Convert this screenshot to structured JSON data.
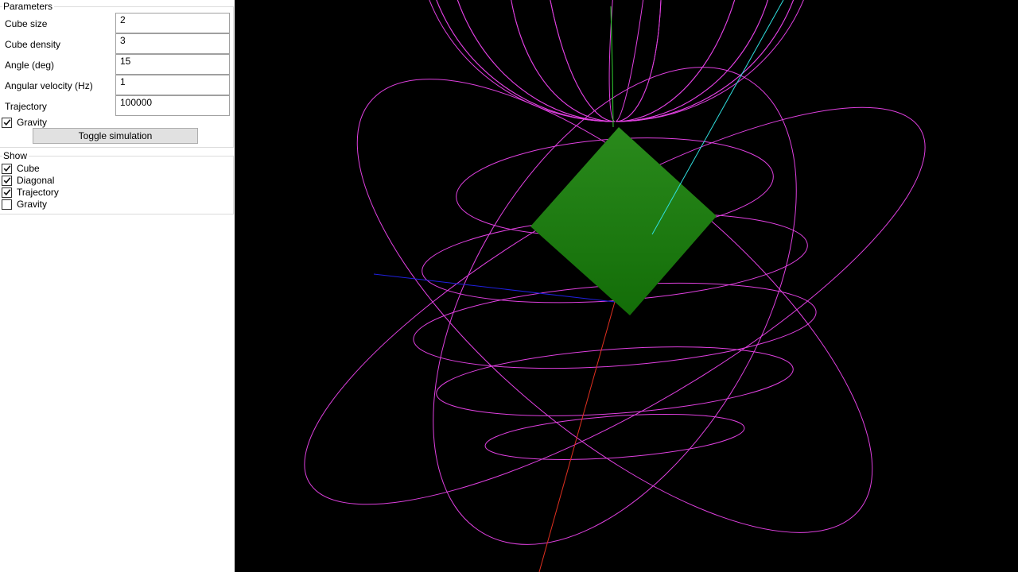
{
  "parameters": {
    "title": "Parameters",
    "fields": [
      {
        "label": "Cube size",
        "value": "2"
      },
      {
        "label": "Cube density",
        "value": "3"
      },
      {
        "label": "Angle (deg)",
        "value": "15"
      },
      {
        "label": "Angular velocity (Hz)",
        "value": "1"
      },
      {
        "label": "Trajectory",
        "value": "100000"
      }
    ],
    "gravity": {
      "label": "Gravity",
      "checked": true
    },
    "toggle_label": "Toggle simulation"
  },
  "show": {
    "title": "Show",
    "items": [
      {
        "label": "Cube",
        "checked": true
      },
      {
        "label": "Diagonal",
        "checked": true
      },
      {
        "label": "Trajectory",
        "checked": true
      },
      {
        "label": "Gravity",
        "checked": false
      }
    ]
  },
  "scene": {
    "background": "#000000",
    "cube_color": "#1f7a10",
    "trajectory_color": "#e040e0",
    "axis_x_color": "#e03020",
    "axis_y_color": "#30d030",
    "axis_z_color": "#2020e0",
    "diagonal_color": "#30e0e0"
  }
}
